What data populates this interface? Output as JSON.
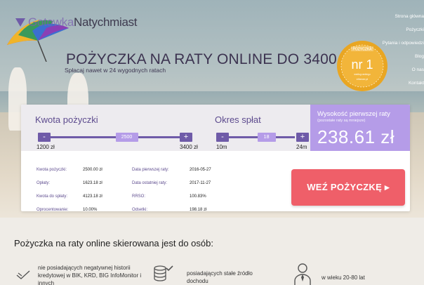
{
  "brand": {
    "part1": "Gotowka",
    "part2": "Natychmiast"
  },
  "nav": [
    "Strona główna",
    "Pożyczki",
    "Pytania i odpowiedzi",
    "Blog",
    "O nas",
    "Kontakt"
  ],
  "hero": {
    "headline": "POŻYCZKA NA RATY ONLINE DO 3400 ZŁ",
    "subline": "Spłacaj nawet w 24 wygodnych ratach"
  },
  "badge": {
    "top": "POŻYCZKA",
    "main": "nr 1",
    "sub1": "według rankingu",
    "sub2": "eltrexer.pl"
  },
  "calculator": {
    "loan": {
      "label": "Kwota pożyczki",
      "value": "2500",
      "min": "1200 zł",
      "max": "3400 zł",
      "minus": "-",
      "plus": "+",
      "fraction": 0.59
    },
    "term": {
      "label": "Okres spłat",
      "value": "18",
      "min": "10m",
      "max": "24m",
      "minus": "-",
      "plus": "+",
      "fraction": 0.57
    },
    "payment": {
      "title": "Wysokość pierwszej raty",
      "note": "(pozostałe raty są mniejsze)",
      "value": "238.61 zł"
    }
  },
  "details": {
    "left": [
      {
        "k": "Kwota pożyczki:",
        "v": "2500.00 zł"
      },
      {
        "k": "Opłaty:",
        "v": "1623.18 zł"
      },
      {
        "k": "Kwota do spłaty:",
        "v": "4123.18 zł"
      },
      {
        "k": "Oprocentowanie:",
        "v": "10.00%"
      }
    ],
    "right": [
      {
        "k": "Data pierwszej raty:",
        "v": "2016-05-27"
      },
      {
        "k": "Data ostatniej raty:",
        "v": "2017-11-27"
      },
      {
        "k": "RRSO:",
        "v": "100.83%"
      },
      {
        "k": "Odsetki:",
        "v": "198.18 zł"
      }
    ]
  },
  "cta": {
    "label": "WEŹ POŻYCZKĘ ▸"
  },
  "section": {
    "title": "Pożyczka na raty online skierowana jest do osób:"
  },
  "features": [
    {
      "icon": "handshake-icon",
      "text": "nie posiadających negatywnej historii kredytowej w BIK, KRD, BIG InfoMonitor i innych"
    },
    {
      "icon": "coins-check-icon",
      "text": "posiadających stałe źródło dochodu"
    },
    {
      "icon": "person-icon",
      "text": "w wieku 20-80 lat"
    }
  ],
  "colors": {
    "accent": "#6f5ba8",
    "accent_light": "#b59ce8",
    "cta": "#ef5f69",
    "heading": "#3c3350"
  }
}
